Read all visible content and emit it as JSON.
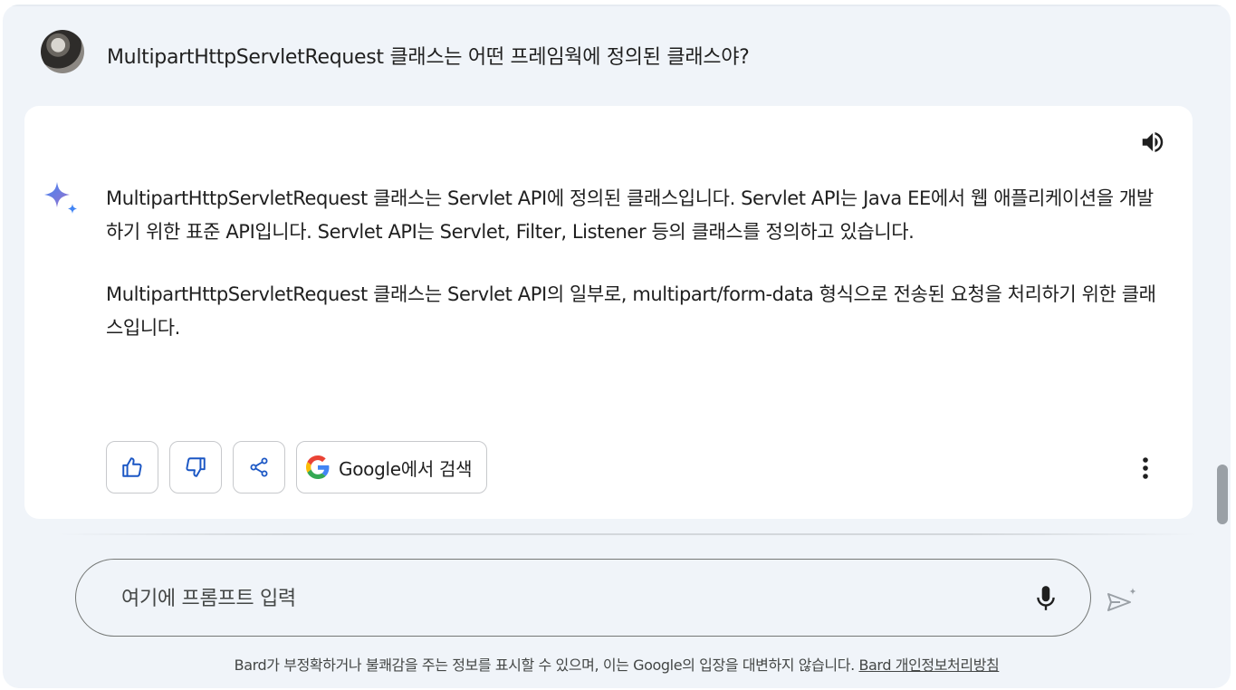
{
  "prompt": {
    "avatar_icon": "user-avatar",
    "text": "MultipartHttpServletRequest 클래스는 어떤 프레임웍에 정의된 클래스야?"
  },
  "answer": {
    "speaker_icon": "volume-up-icon",
    "sparkle_icon": "bard-sparkle-icon",
    "paragraphs": [
      "MultipartHttpServletRequest 클래스는 Servlet API에 정의된 클래스입니다. Servlet API는 Java EE에서 웹 애플리케이션을 개발하기 위한 표준 API입니다. Servlet API는 Servlet, Filter, Listener 등의 클래스를 정의하고 있습니다.",
      "MultipartHttpServletRequest 클래스는 Servlet API의 일부로, multipart/form-data 형식으로 전송된 요청을 처리하기 위한 클래스입니다."
    ],
    "actions": {
      "thumbs_up_icon": "thumbs-up-icon",
      "thumbs_down_icon": "thumbs-down-icon",
      "share_icon": "share-icon",
      "google_search_label": "Google에서 검색",
      "more_icon": "more-vert-icon"
    }
  },
  "input": {
    "placeholder": "여기에 프롬프트 입력",
    "value": "",
    "mic_icon": "mic-icon",
    "send_icon": "send-icon"
  },
  "footer": {
    "disclaimer": "Bard가 부정확하거나 불쾌감을 주는 정보를 표시할 수 있으며, 이는 Google의 입장을 대변하지 않습니다.",
    "privacy_link": "Bard 개인정보처리방침"
  },
  "colors": {
    "background": "#f0f4f9",
    "card": "#ffffff",
    "accent_blue": "#1a73e8",
    "sparkle_blue": "#4285f4",
    "text": "#1f1f1f"
  }
}
